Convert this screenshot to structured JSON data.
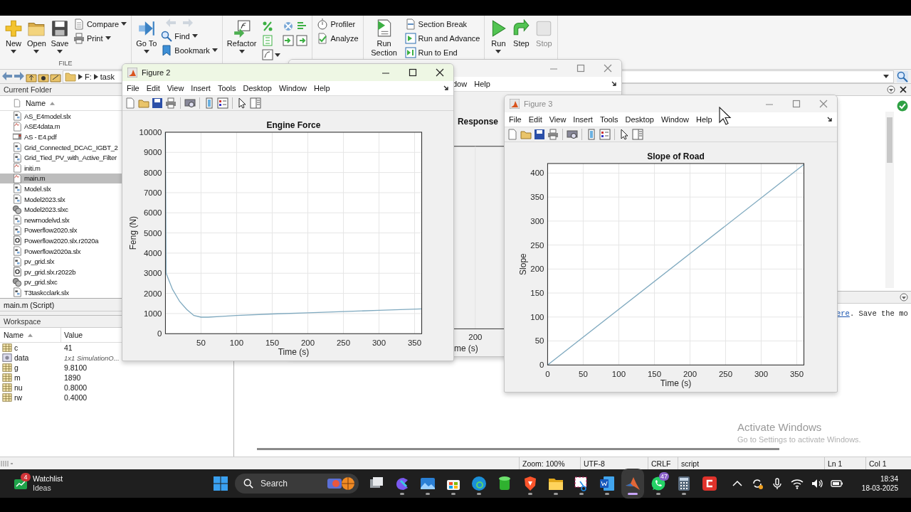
{
  "toolstrip": {
    "sections": [
      {
        "label": "FILE",
        "columns": [
          {
            "kind": "large",
            "label": "New",
            "dropdown": true,
            "disabled": false
          },
          {
            "kind": "large",
            "label": "Open",
            "dropdown": true,
            "disabled": false
          },
          {
            "kind": "large",
            "label": "Save",
            "dropdown": true,
            "disabled": false
          },
          {
            "kind": "stack",
            "items": [
              {
                "kind": "button",
                "label": "Compare",
                "dropdown": true
              },
              {
                "kind": "button",
                "label": "Print",
                "dropdown": true
              }
            ]
          }
        ]
      },
      {
        "columns": [
          {
            "kind": "large",
            "label": "Go To",
            "dropdown": true,
            "disabled": false
          },
          {
            "kind": "stack",
            "items": [
              {
                "kind": "nav_arrows"
              },
              {
                "kind": "button",
                "label": "Find",
                "dropdown": true
              },
              {
                "kind": "button",
                "label": "Bookmark",
                "dropdown": true
              }
            ]
          }
        ]
      },
      {
        "columns": [
          {
            "kind": "large",
            "label": "Refactor",
            "dropdown": true,
            "disabled": false
          },
          {
            "kind": "icon_grid"
          }
        ]
      },
      {
        "columns": [
          {
            "kind": "stack",
            "items": [
              {
                "kind": "button",
                "label": "Profiler",
                "dropdown": false
              },
              {
                "kind": "button",
                "label": "Analyze",
                "dropdown": false
              }
            ]
          }
        ]
      },
      {
        "columns": [
          {
            "kind": "large",
            "label": "Run Section",
            "dropdown": false,
            "disabled": false
          },
          {
            "kind": "stack",
            "items": [
              {
                "kind": "button",
                "label": "Section Break",
                "dropdown": false
              },
              {
                "kind": "button",
                "label": "Run and Advance",
                "dropdown": false
              },
              {
                "kind": "button",
                "label": "Run to End",
                "dropdown": false
              }
            ]
          }
        ]
      },
      {
        "columns": [
          {
            "kind": "large",
            "label": "Run",
            "dropdown": true,
            "disabled": false
          },
          {
            "kind": "large",
            "label": "Step",
            "dropdown": false,
            "disabled": false
          },
          {
            "kind": "large",
            "label": "Stop",
            "dropdown": false,
            "disabled": true
          }
        ]
      }
    ]
  },
  "address": {
    "path": [
      "F:",
      "task"
    ]
  },
  "current_folder": {
    "title": "Current Folder",
    "column": "Name",
    "files": [
      {
        "name": "AS_E4model.slx",
        "kind": "slx",
        "selected": false
      },
      {
        "name": "ASE4data.m",
        "kind": "m",
        "selected": false
      },
      {
        "name": "AS - E4.pdf",
        "kind": "pdf",
        "selected": false
      },
      {
        "name": "Grid_Connected_DCAC_IGBT_2",
        "kind": "slx",
        "selected": false
      },
      {
        "name": "Grid_Tied_PV_with_Active_Filter",
        "kind": "slx",
        "selected": false
      },
      {
        "name": "initi.m",
        "kind": "m",
        "selected": false
      },
      {
        "name": "main.m",
        "kind": "m",
        "selected": true
      },
      {
        "name": "Model.slx",
        "kind": "slx",
        "selected": false
      },
      {
        "name": "Model2023.slx",
        "kind": "slx",
        "selected": false
      },
      {
        "name": "Model2023.slxc",
        "kind": "slxc",
        "selected": false
      },
      {
        "name": "newmodelvd.slx",
        "kind": "slx",
        "selected": false
      },
      {
        "name": "Powerflow2020.slx",
        "kind": "slx",
        "selected": false
      },
      {
        "name": "Powerflow2020.slx.r2020a",
        "kind": "backup",
        "selected": false
      },
      {
        "name": "Powerflow2020a.slx",
        "kind": "slx",
        "selected": false
      },
      {
        "name": "pv_grid.slx",
        "kind": "slx",
        "selected": false
      },
      {
        "name": "pv_grid.slx.r2022b",
        "kind": "backup",
        "selected": false
      },
      {
        "name": "pv_grid.slxc",
        "kind": "slxc",
        "selected": false
      },
      {
        "name": "T3taskcclark.slx",
        "kind": "slx",
        "selected": false
      }
    ],
    "details": "main.m  (Script)"
  },
  "workspace": {
    "title": "Workspace",
    "columns": [
      "Name",
      "Value"
    ],
    "rows": [
      {
        "name": "c",
        "value": "41",
        "kind": "array"
      },
      {
        "name": "data",
        "value": "1x1 SimulationO...",
        "kind": "object"
      },
      {
        "name": "g",
        "value": "9.8100",
        "kind": "array"
      },
      {
        "name": "m",
        "value": "1890",
        "kind": "array"
      },
      {
        "name": "nu",
        "value": "0.8000",
        "kind": "array"
      },
      {
        "name": "rw",
        "value": "0.4000",
        "kind": "array"
      }
    ]
  },
  "background_figure": {
    "menu": [
      "dow",
      "Help"
    ],
    "chart_title": "Response",
    "xtick": "200",
    "xlabel": "me (s)"
  },
  "figures": [
    {
      "title": "Figure 2",
      "active": true,
      "menu": [
        "File",
        "Edit",
        "View",
        "Insert",
        "Tools",
        "Desktop",
        "Window",
        "Help"
      ],
      "chart_data": {
        "type": "line",
        "title": "Engine Force",
        "xlabel": "Time (s)",
        "ylabel": "Feng (N)",
        "xlim": [
          0,
          360
        ],
        "ylim": [
          0,
          10000
        ],
        "xticks": [
          50,
          100,
          150,
          200,
          250,
          300,
          350
        ],
        "yticks": [
          0,
          1000,
          2000,
          3000,
          4000,
          5000,
          6000,
          7000,
          8000,
          9000,
          10000
        ],
        "x": [
          0,
          1,
          10,
          20,
          30,
          40,
          50,
          60,
          80,
          100,
          150,
          200,
          250,
          300,
          360
        ],
        "grid": true,
        "series": [
          {
            "color": "#7fa9bf",
            "values": [
              10000,
              3000,
              2200,
              1600,
              1200,
              900,
              820,
              820,
              860,
              900,
              980,
              1040,
              1100,
              1160,
              1230
            ]
          }
        ]
      }
    },
    {
      "title": "Figure 3",
      "active": false,
      "menu": [
        "File",
        "Edit",
        "View",
        "Insert",
        "Tools",
        "Desktop",
        "Window",
        "Help"
      ],
      "chart_data": {
        "type": "line",
        "title": "Slope of Road",
        "xlabel": "Time (s)",
        "ylabel": "Slope",
        "xlim": [
          0,
          360
        ],
        "ylim": [
          0,
          420
        ],
        "xticks": [
          0,
          50,
          100,
          150,
          200,
          250,
          300,
          350
        ],
        "yticks": [
          0,
          50,
          100,
          150,
          200,
          250,
          300,
          350,
          400
        ],
        "x": [
          0,
          360
        ],
        "grid": true,
        "series": [
          {
            "color": "#7fa9bf",
            "values": [
              0,
              418
            ]
          }
        ]
      }
    }
  ],
  "command_window": {
    "link": "ere",
    "text": ". Save the mo"
  },
  "activation": {
    "title": "Activate Windows",
    "hint": "Go to Settings to activate Windows."
  },
  "status_bar": [
    "Zoom: 100%",
    "UTF-8",
    "CRLF",
    "script",
    "Ln 1",
    "Col 1"
  ],
  "taskbar": {
    "widget": {
      "badge": "4",
      "title": "Watchlist",
      "subtitle": "Ideas"
    },
    "search": {
      "placeholder": "Search"
    },
    "apps": [
      {
        "running": false,
        "active": false
      },
      {
        "running": true,
        "active": false
      },
      {
        "running": true,
        "active": false
      },
      {
        "running": true,
        "active": false
      },
      {
        "running": true,
        "active": false
      },
      {
        "running": false,
        "active": false
      },
      {
        "running": true,
        "active": false
      },
      {
        "running": true,
        "active": false
      },
      {
        "running": true,
        "active": false
      },
      {
        "running": true,
        "active": false
      },
      {
        "running": true,
        "active": true
      },
      {
        "running": true,
        "active": false,
        "badge": "47"
      },
      {
        "running": true,
        "active": false
      },
      {
        "running": false,
        "active": false
      }
    ],
    "clock": {
      "time": "18:34",
      "date": "18-03-2025"
    }
  }
}
